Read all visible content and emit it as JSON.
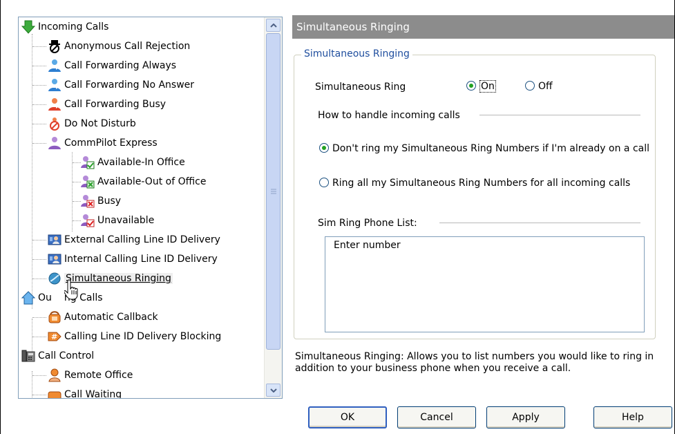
{
  "tree": {
    "items": [
      {
        "label": "Incoming Calls",
        "icon": "green-down-arrow-icon"
      },
      {
        "label": "Anonymous Call Rejection",
        "icon": "anonymous-icon"
      },
      {
        "label": "Call Forwarding Always",
        "icon": "user-forward-icon"
      },
      {
        "label": "Call Forwarding No Answer",
        "icon": "user-forward-icon"
      },
      {
        "label": "Call Forwarding Busy",
        "icon": "user-busy-icon"
      },
      {
        "label": "Do Not Disturb",
        "icon": "do-not-disturb-icon"
      },
      {
        "label": "CommPilot Express",
        "icon": "user-purple-icon"
      },
      {
        "label": "Available-In Office",
        "icon": "profile-check-icon"
      },
      {
        "label": "Available-Out of Office",
        "icon": "profile-out-icon"
      },
      {
        "label": "Busy",
        "icon": "profile-busy-icon"
      },
      {
        "label": "Unavailable",
        "icon": "profile-unavailable-icon"
      },
      {
        "label": "External Calling Line ID Delivery",
        "icon": "id-card-icon"
      },
      {
        "label": "Internal Calling Line ID Delivery",
        "icon": "id-card-icon"
      },
      {
        "label": "Simultaneous Ringing",
        "icon": "globe-icon"
      },
      {
        "label": "Outgoing Calls",
        "icon": "blue-house-icon",
        "visible_label": "Ou",
        "visible_label_rest": "ng Calls"
      },
      {
        "label": "Automatic Callback",
        "icon": "callback-phone-icon"
      },
      {
        "label": "Calling Line ID Delivery Blocking",
        "icon": "hash-block-icon"
      },
      {
        "label": "Call Control",
        "icon": "desk-phone-icon"
      },
      {
        "label": "Remote Office",
        "icon": "remote-office-icon"
      },
      {
        "label": "Call Waiting",
        "icon": "call-waiting-icon"
      }
    ],
    "selected_index": 13
  },
  "panel": {
    "header": "Simultaneous Ringing",
    "group_title": "Simultaneous Ringing",
    "sim_ring_label": "Simultaneous Ring",
    "on_label": "On",
    "off_label": "Off",
    "sim_ring_value": "On",
    "handle_label": "How to handle incoming calls",
    "option_no_ring": "Don't ring my Simultaneous Ring Numbers if I'm already on a call",
    "option_ring_all": "Ring all my Simultaneous Ring Numbers for all incoming calls",
    "handle_value": "option_no_ring",
    "phone_list_label": "Sim Ring Phone List:",
    "phone_list_text": "Enter number",
    "description": "Simultaneous Ringing: Allows you to list numbers you would like to ring in addition to your business phone when you receive a call."
  },
  "buttons": {
    "ok": "OK",
    "cancel": "Cancel",
    "apply": "Apply",
    "help": "Help"
  },
  "colors": {
    "header_bg": "#8c8c8c",
    "group_title": "#1f4e9e",
    "radio_dot": "#21a121",
    "button_border": "#003c74"
  }
}
